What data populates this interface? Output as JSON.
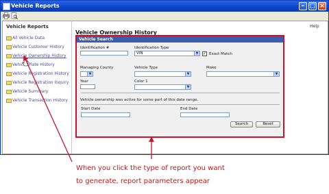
{
  "window": {
    "title": "Vehicle Reports",
    "min_label": "–",
    "max_label": "□",
    "close_label": "×"
  },
  "toolbar": {
    "icons": [
      "print-icon",
      "preview-icon"
    ]
  },
  "sidebar": {
    "heading": "Vehicle Reports",
    "items": [
      {
        "label": "All Vehicle Data"
      },
      {
        "label": "Vehicle Customer History"
      },
      {
        "label": "Vehicle Ownership History"
      },
      {
        "label": "Vehicle Plate History"
      },
      {
        "label": "Vehicle Registration History"
      },
      {
        "label": "Vehicle Registration Inquiry"
      },
      {
        "label": "Vehicle Summary"
      },
      {
        "label": "Vehicle Transaction History"
      }
    ]
  },
  "help_link": "Help",
  "page_title": "Vehicle Ownership History",
  "search": {
    "title": "Vehicle Search",
    "identification_label": "Identification #",
    "identification_value": "",
    "id_type_label": "Identification Type",
    "id_type_value": "VIN",
    "exact_match_label": "Exact Match",
    "exact_match_check": "✓",
    "managing_county_label": "Managing County",
    "vehicle_type_label": "Vehicle Type",
    "make_label": "Make",
    "year_label": "Year",
    "color_label": "Color 1",
    "active_note": "Vehicle ownership was active for some part of this date range.",
    "start_date_label": "Start Date",
    "end_date_label": "End Date",
    "search_button": "Search",
    "reset_button": "Reset",
    "select_arrow": "▼"
  },
  "caption": {
    "line1": "When you click the type of report you want",
    "line2": "to generate, report parameters appear"
  },
  "colors": {
    "annotation": "#d0102a",
    "titlebar": "#0b44c9",
    "panel_header": "#3a5fb0"
  }
}
